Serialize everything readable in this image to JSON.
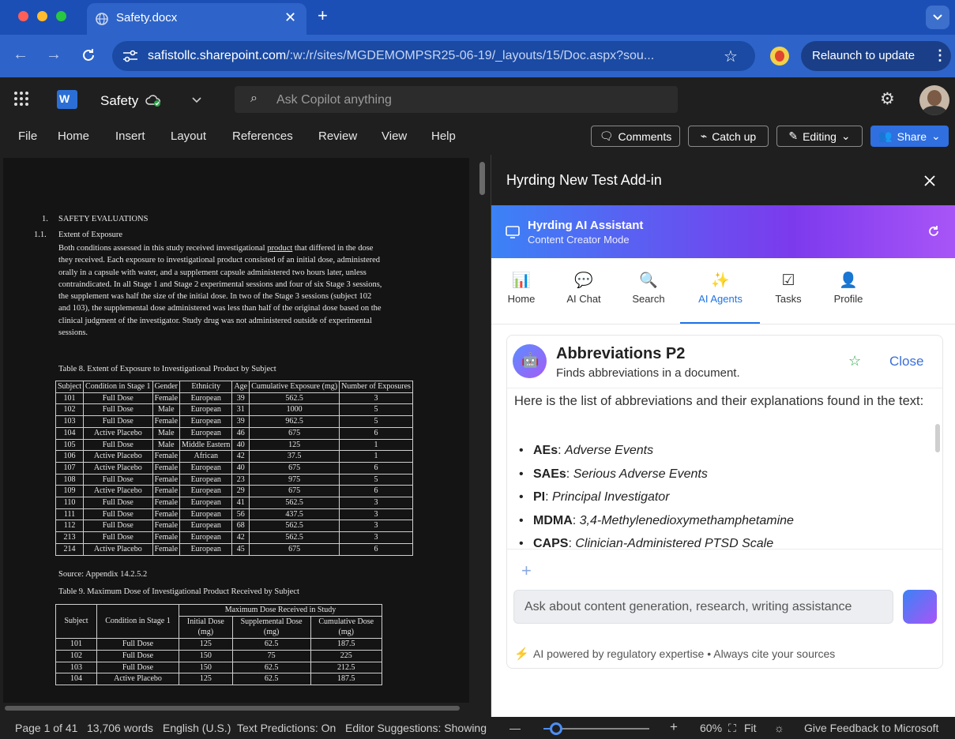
{
  "browser": {
    "tab_title": "Safety.docx",
    "url_host": "safistollc.sharepoint.com",
    "url_path": "/:w:/r/sites/MGDEMOMPSR25-06-19/_layouts/15/Doc.aspx?sou...",
    "relaunch_label": "Relaunch to update"
  },
  "word": {
    "doc_name": "Safety",
    "copilot_placeholder": "Ask Copilot anything",
    "menu": [
      "File",
      "Home",
      "Insert",
      "Layout",
      "References",
      "Review",
      "View",
      "Help"
    ],
    "comments_label": "Comments",
    "catchup_label": "Catch up",
    "editing_label": "Editing",
    "share_label": "Share"
  },
  "document": {
    "h1_num": "1.",
    "h1": "SAFETY EVALUATIONS",
    "h2_num": "1.1.",
    "h2": "Extent of Exposure",
    "para_lines": [
      "Both conditions assessed in this study received investigational product that differed in the dose",
      "they received. Each exposure to investigational product consisted of an initial dose, administered",
      "orally in a capsule with water, and a supplement capsule administered two hours later, unless",
      "contraindicated. In all Stage 1 and Stage 2 experimental sessions and four of six Stage 3 sessions,",
      "the supplement was half the size of the initial dose.  In two of the Stage 3 sessions (subject 102",
      "and 103), the supplemental dose administered was less than half of the original dose based on the",
      "clinical judgment of the investigator. Study drug was not administered outside of experimental",
      "sessions."
    ],
    "table8_caption": "Table 8. Extent of Exposure to Investigational Product by Subject",
    "table8_headers": [
      "Subject",
      "Condition in Stage 1",
      "Gender",
      "Ethnicity",
      "Age",
      "Cumulative Exposure (mg)",
      "Number of Exposures"
    ],
    "table8_rows": [
      [
        "101",
        "Full Dose",
        "Female",
        "European",
        "39",
        "562.5",
        "3"
      ],
      [
        "102",
        "Full Dose",
        "Male",
        "European",
        "31",
        "1000",
        "5"
      ],
      [
        "103",
        "Full Dose",
        "Female",
        "European",
        "39",
        "962.5",
        "5"
      ],
      [
        "104",
        "Active Placebo",
        "Male",
        "European",
        "46",
        "675",
        "6"
      ],
      [
        "105",
        "Full Dose",
        "Male",
        "Middle Eastern",
        "40",
        "125",
        "1"
      ],
      [
        "106",
        "Active Placebo",
        "Female",
        "African",
        "42",
        "37.5",
        "1"
      ],
      [
        "107",
        "Active Placebo",
        "Female",
        "European",
        "40",
        "675",
        "6"
      ],
      [
        "108",
        "Full Dose",
        "Female",
        "European",
        "23",
        "975",
        "5"
      ],
      [
        "109",
        "Active Placebo",
        "Female",
        "European",
        "29",
        "675",
        "6"
      ],
      [
        "110",
        "Full Dose",
        "Female",
        "European",
        "41",
        "562.5",
        "3"
      ],
      [
        "111",
        "Full Dose",
        "Female",
        "European",
        "56",
        "437.5",
        "3"
      ],
      [
        "112",
        "Full Dose",
        "Female",
        "European",
        "68",
        "562.5",
        "3"
      ],
      [
        "213",
        "Full Dose",
        "Female",
        "European",
        "42",
        "562.5",
        "3"
      ],
      [
        "214",
        "Active Placebo",
        "Female",
        "European",
        "45",
        "675",
        "6"
      ]
    ],
    "table8_source": "Source: Appendix 14.2.5.2",
    "table9_caption": "Table 9. Maximum Dose of Investigational Product Received by Subject",
    "table9_h_subject": "Subject",
    "table9_h_condition": "Condition in Stage 1",
    "table9_h_group": "Maximum Dose Received in Study",
    "table9_subheaders": [
      "Initial Dose (mg)",
      "Supplemental Dose (mg)",
      "Cumulative Dose (mg)"
    ],
    "table9_rows": [
      [
        "101",
        "Full Dose",
        "125",
        "62.5",
        "187.5"
      ],
      [
        "102",
        "Full Dose",
        "150",
        "75",
        "225"
      ],
      [
        "103",
        "Full Dose",
        "150",
        "62.5",
        "212.5"
      ],
      [
        "104",
        "Active Placebo",
        "125",
        "62.5",
        "187.5"
      ]
    ]
  },
  "addin": {
    "pane_title": "Hyrding New Test Add-in",
    "assistant_title": "Hyrding AI Assistant",
    "assistant_mode": "Content Creator Mode",
    "nav": [
      {
        "label": "Home",
        "icon": "📊"
      },
      {
        "label": "AI Chat",
        "icon": "💬"
      },
      {
        "label": "Search",
        "icon": "🔍"
      },
      {
        "label": "AI Agents",
        "icon": "✨"
      },
      {
        "label": "Tasks",
        "icon": "☑"
      },
      {
        "label": "Profile",
        "icon": "👤"
      }
    ],
    "agent_title": "Abbreviations P2",
    "agent_desc": "Finds abbreviations in a document.",
    "close_label": "Close",
    "intro": "Here is the list of abbreviations and their explanations found in the text:",
    "abbrevs": [
      {
        "term": "AEs",
        "def": "Adverse Events"
      },
      {
        "term": "SAEs",
        "def": "Serious Adverse Events"
      },
      {
        "term": "PI",
        "def": "Principal Investigator"
      },
      {
        "term": "MDMA",
        "def": "3,4-Methylenedioxymethamphetamine"
      },
      {
        "term": "CAPS",
        "def": "Clinician-Administered PTSD Scale"
      }
    ],
    "input_placeholder": "Ask about content generation, research, writing assistance",
    "footer_note": "AI powered by regulatory expertise • Always cite your sources"
  },
  "status": {
    "page": "Page 1 of 41",
    "words": "13,706 words",
    "language": "English (U.S.)",
    "predictions": "Text Predictions: On",
    "editor": "Editor Suggestions: Showing",
    "zoom": "60%",
    "fit": "Fit",
    "feedback": "Give Feedback to Microsoft",
    "zoom_level_fraction": 0.12
  },
  "colors": {
    "browser_blue": "#2e64c9",
    "share_blue": "#2f6fe0",
    "accent_blue": "#3b6fd8",
    "agents_accent": "#1e73e8"
  }
}
